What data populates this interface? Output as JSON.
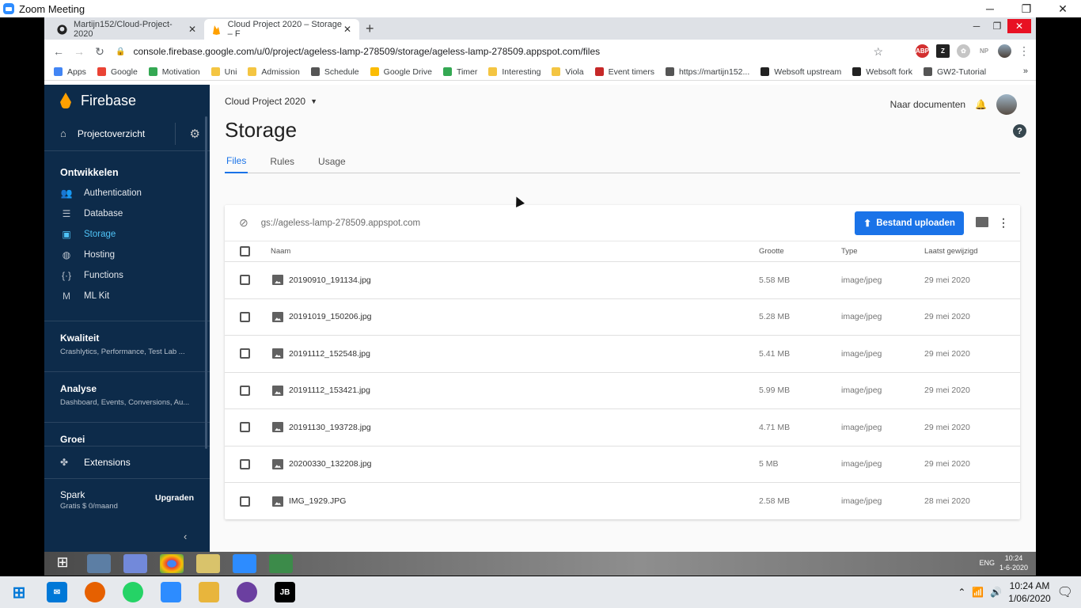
{
  "zoom": {
    "title": "Zoom Meeting"
  },
  "browser": {
    "tabs": [
      {
        "label": "Martijn152/Cloud-Project-2020"
      },
      {
        "label": "Cloud Project 2020 – Storage – F"
      }
    ],
    "url": "console.firebase.google.com/u/0/project/ageless-lamp-278509/storage/ageless-lamp-278509.appspot.com/files",
    "extensions": [
      "ABP",
      "Z",
      "NP"
    ],
    "bookmarks": [
      {
        "label": "Apps",
        "color": "#4285f4"
      },
      {
        "label": "Google",
        "color": "#ea4335"
      },
      {
        "label": "Motivation",
        "color": "#34a853"
      },
      {
        "label": "Uni",
        "color": "#f4c542"
      },
      {
        "label": "Admission",
        "color": "#f4c542"
      },
      {
        "label": "Schedule",
        "color": "#555555"
      },
      {
        "label": "Google Drive",
        "color": "#fbbc04"
      },
      {
        "label": "Timer",
        "color": "#34a853"
      },
      {
        "label": "Interesting",
        "color": "#f4c542"
      },
      {
        "label": "Viola",
        "color": "#f4c542"
      },
      {
        "label": "Event timers",
        "color": "#c62828"
      },
      {
        "label": "https://martijn152...",
        "color": "#555555"
      },
      {
        "label": "Websoft upstream",
        "color": "#222222"
      },
      {
        "label": "Websoft fork",
        "color": "#222222"
      },
      {
        "label": "GW2-Tutorial",
        "color": "#555555"
      }
    ],
    "more_bookmarks": "»"
  },
  "sidebar": {
    "brand": "Firebase",
    "project_overview": "Projectoverzicht",
    "develop_heading": "Ontwikkelen",
    "items": [
      {
        "label": "Authentication",
        "icon": "people-icon"
      },
      {
        "label": "Database",
        "icon": "database-icon"
      },
      {
        "label": "Storage",
        "icon": "image-icon"
      },
      {
        "label": "Hosting",
        "icon": "globe-icon"
      },
      {
        "label": "Functions",
        "icon": "functions-icon"
      },
      {
        "label": "ML Kit",
        "icon": "mlkit-icon"
      }
    ],
    "sections": [
      {
        "title": "Kwaliteit",
        "subtitle": "Crashlytics, Performance, Test Lab ..."
      },
      {
        "title": "Analyse",
        "subtitle": "Dashboard, Events, Conversions, Au..."
      },
      {
        "title": "Groei",
        "subtitle": ""
      }
    ],
    "extensions": "Extensions",
    "plan": {
      "title": "Spark",
      "subtitle": "Gratis $ 0/maand",
      "upgrade": "Upgraden"
    }
  },
  "main": {
    "project_selector": "Cloud Project 2020",
    "docs_link": "Naar documenten",
    "title": "Storage",
    "tabs": [
      "Files",
      "Rules",
      "Usage"
    ],
    "bucket_path": "gs://ageless-lamp-278509.appspot.com",
    "upload_button": "Bestand uploaden",
    "columns": {
      "name": "Naam",
      "size": "Grootte",
      "type": "Type",
      "modified": "Laatst gewijzigd"
    },
    "files": [
      {
        "name": "20190910_191134.jpg",
        "size": "5.58 MB",
        "type": "image/jpeg",
        "modified": "29 mei 2020"
      },
      {
        "name": "20191019_150206.jpg",
        "size": "5.28 MB",
        "type": "image/jpeg",
        "modified": "29 mei 2020"
      },
      {
        "name": "20191112_152548.jpg",
        "size": "5.41 MB",
        "type": "image/jpeg",
        "modified": "29 mei 2020"
      },
      {
        "name": "20191112_153421.jpg",
        "size": "5.99 MB",
        "type": "image/jpeg",
        "modified": "29 mei 2020"
      },
      {
        "name": "20191130_193728.jpg",
        "size": "4.71 MB",
        "type": "image/jpeg",
        "modified": "29 mei 2020"
      },
      {
        "name": "20200330_132208.jpg",
        "size": "5 MB",
        "type": "image/jpeg",
        "modified": "29 mei 2020"
      },
      {
        "name": "IMG_1929.JPG",
        "size": "2.58 MB",
        "type": "image/jpeg",
        "modified": "28 mei 2020"
      }
    ]
  },
  "remote_taskbar": {
    "lang": "ENG",
    "time": "10:24",
    "date": "1-6-2020"
  },
  "local_taskbar": {
    "time": "10:24 AM",
    "date": "1/06/2020",
    "jb": "JB"
  },
  "colors": {
    "accent": "#1a73e8",
    "sidebar": "#0d2b4a",
    "active_nav": "#4fc3f7"
  }
}
